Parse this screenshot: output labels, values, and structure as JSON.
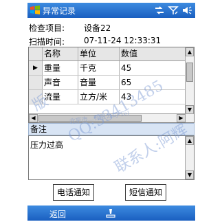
{
  "titlebar": {
    "title": "异常记录"
  },
  "info": {
    "item_label": "检查项目:",
    "item_value": "设备22",
    "scan_label": "扫描时间:",
    "scan_value": "07-11-24 12:33:31"
  },
  "grid": {
    "columns": [
      "名称",
      "单位",
      "数值"
    ],
    "rows": [
      {
        "name": "重量",
        "unit": "千克",
        "value": "45",
        "selected": true
      },
      {
        "name": "声音",
        "unit": "音量",
        "value": "65",
        "selected": false
      },
      {
        "name": "流量",
        "unit": "立方/米",
        "value": "43",
        "selected": false
      }
    ]
  },
  "notes": {
    "label": "备注",
    "value": "压力过高"
  },
  "buttons": {
    "phone": "电话通知",
    "sms": "短信通知"
  },
  "bottombar": {
    "back": "返回"
  },
  "watermark": {
    "line1": "版",
    "line2": "QQ:33413485",
    "line3": "联系人:阿辉",
    "line4": "北京市...有限公司 Tel"
  },
  "colors": {
    "title_bar": "#1a5fc0",
    "notes_label_bg": "#d8e4f4"
  }
}
